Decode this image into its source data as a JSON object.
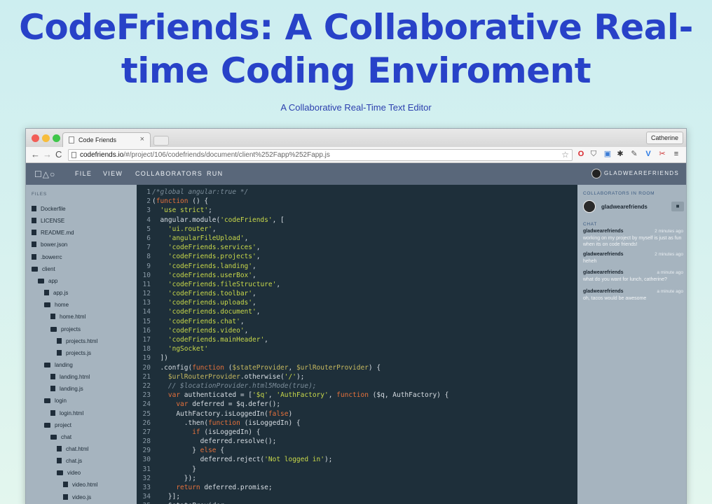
{
  "page": {
    "title_line1": "CodeFriends: A Collaborative Real-",
    "title_line2": "time Coding Enviroment",
    "subtitle": "A Collaborative Real-Time Text Editor"
  },
  "browser": {
    "tab_title": "Code Friends",
    "tab_close": "×",
    "profile_name": "Catherine",
    "url_host": "codefriends.io",
    "url_path": "/#/project/106/codefriends/document/client%252Fapp%252Fapp.js"
  },
  "app_nav": {
    "logo": "☐△○",
    "menu": [
      "FILE",
      "VIEW",
      "COLLABORATORS",
      "RUN"
    ],
    "username": "GLADWEAREFRIENDS"
  },
  "files": {
    "header": "FILES",
    "items": [
      {
        "name": "Dockerfile",
        "type": "file",
        "depth": 0
      },
      {
        "name": "LICENSE",
        "type": "file",
        "depth": 0
      },
      {
        "name": "README.md",
        "type": "file",
        "depth": 0
      },
      {
        "name": "bower.json",
        "type": "file",
        "depth": 0
      },
      {
        "name": ".bowerrc",
        "type": "file",
        "depth": 0
      },
      {
        "name": "client",
        "type": "folder",
        "depth": 0
      },
      {
        "name": "app",
        "type": "folder",
        "depth": 1
      },
      {
        "name": "app.js",
        "type": "file",
        "depth": 2
      },
      {
        "name": "home",
        "type": "folder",
        "depth": 2
      },
      {
        "name": "home.html",
        "type": "file",
        "depth": 3
      },
      {
        "name": "projects",
        "type": "folder",
        "depth": 3
      },
      {
        "name": "projects.html",
        "type": "file",
        "depth": 4
      },
      {
        "name": "projects.js",
        "type": "file",
        "depth": 4
      },
      {
        "name": "landing",
        "type": "folder",
        "depth": 2
      },
      {
        "name": "landing.html",
        "type": "file",
        "depth": 3
      },
      {
        "name": "landing.js",
        "type": "file",
        "depth": 3
      },
      {
        "name": "login",
        "type": "folder",
        "depth": 2
      },
      {
        "name": "login.html",
        "type": "file",
        "depth": 3
      },
      {
        "name": "project",
        "type": "folder",
        "depth": 2
      },
      {
        "name": "chat",
        "type": "folder",
        "depth": 3
      },
      {
        "name": "chat.html",
        "type": "file",
        "depth": 4
      },
      {
        "name": "chat.js",
        "type": "file",
        "depth": 4
      },
      {
        "name": "video",
        "type": "folder",
        "depth": 4
      },
      {
        "name": "video.html",
        "type": "file",
        "depth": 5
      },
      {
        "name": "video.js",
        "type": "file",
        "depth": 5
      }
    ]
  },
  "editor": {
    "lines": [
      [
        [
          "c-cm",
          "/*global angular:true */"
        ]
      ],
      [
        [
          "c-txt",
          "("
        ],
        [
          "c-kw",
          "function"
        ],
        [
          "c-txt",
          " () {"
        ]
      ],
      [
        [
          "c-txt",
          "  "
        ],
        [
          "c-str",
          "'use strict'"
        ],
        [
          "c-txt",
          ";"
        ]
      ],
      [
        [
          "c-txt",
          "  angular.module("
        ],
        [
          "c-str",
          "'codeFriends'"
        ],
        [
          "c-txt",
          ", ["
        ]
      ],
      [
        [
          "c-txt",
          "    "
        ],
        [
          "c-str",
          "'ui.router'"
        ],
        [
          "c-txt",
          ","
        ]
      ],
      [
        [
          "c-txt",
          "    "
        ],
        [
          "c-str",
          "'angularFileUpload'"
        ],
        [
          "c-txt",
          ","
        ]
      ],
      [
        [
          "c-txt",
          "    "
        ],
        [
          "c-str",
          "'codeFriends.services'"
        ],
        [
          "c-txt",
          ","
        ]
      ],
      [
        [
          "c-txt",
          "    "
        ],
        [
          "c-str",
          "'codeFriends.projects'"
        ],
        [
          "c-txt",
          ","
        ]
      ],
      [
        [
          "c-txt",
          "    "
        ],
        [
          "c-str",
          "'codeFriends.landing'"
        ],
        [
          "c-txt",
          ","
        ]
      ],
      [
        [
          "c-txt",
          "    "
        ],
        [
          "c-str",
          "'codeFriends.userBox'"
        ],
        [
          "c-txt",
          ","
        ]
      ],
      [
        [
          "c-txt",
          "    "
        ],
        [
          "c-str",
          "'codeFriends.fileStructure'"
        ],
        [
          "c-txt",
          ","
        ]
      ],
      [
        [
          "c-txt",
          "    "
        ],
        [
          "c-str",
          "'codeFriends.toolbar'"
        ],
        [
          "c-txt",
          ","
        ]
      ],
      [
        [
          "c-txt",
          "    "
        ],
        [
          "c-str",
          "'codeFriends.uploads'"
        ],
        [
          "c-txt",
          ","
        ]
      ],
      [
        [
          "c-txt",
          "    "
        ],
        [
          "c-str",
          "'codeFriends.document'"
        ],
        [
          "c-txt",
          ","
        ]
      ],
      [
        [
          "c-txt",
          "    "
        ],
        [
          "c-str",
          "'codeFriends.chat'"
        ],
        [
          "c-txt",
          ","
        ]
      ],
      [
        [
          "c-txt",
          "    "
        ],
        [
          "c-str",
          "'codeFriends.video'"
        ],
        [
          "c-txt",
          ","
        ]
      ],
      [
        [
          "c-txt",
          "    "
        ],
        [
          "c-str",
          "'codeFriends.mainHeader'"
        ],
        [
          "c-txt",
          ","
        ]
      ],
      [
        [
          "c-txt",
          "    "
        ],
        [
          "c-str",
          "'ngSocket'"
        ]
      ],
      [
        [
          "c-txt",
          "  ])"
        ]
      ],
      [
        [
          "c-txt",
          "  .config("
        ],
        [
          "c-kw",
          "function"
        ],
        [
          "c-txt",
          " ("
        ],
        [
          "c-var",
          "$stateProvider"
        ],
        [
          "c-txt",
          ", "
        ],
        [
          "c-var",
          "$urlRouterProvider"
        ],
        [
          "c-txt",
          ") {"
        ]
      ],
      [
        [
          "c-txt",
          "    "
        ],
        [
          "c-var",
          "$urlRouterProvider"
        ],
        [
          "c-txt",
          ".otherwise("
        ],
        [
          "c-str",
          "'/'"
        ],
        [
          "c-txt",
          ");"
        ]
      ],
      [
        [
          "c-txt",
          "    "
        ],
        [
          "c-cm",
          "// $locationProvider.html5Mode(true);"
        ]
      ],
      [
        [
          "c-txt",
          "    "
        ],
        [
          "c-kw",
          "var"
        ],
        [
          "c-txt",
          " authenticated = ["
        ],
        [
          "c-str",
          "'$q'"
        ],
        [
          "c-txt",
          ", "
        ],
        [
          "c-str",
          "'AuthFactory'"
        ],
        [
          "c-txt",
          ", "
        ],
        [
          "c-kw",
          "function"
        ],
        [
          "c-txt",
          " ($q, AuthFactory) {"
        ]
      ],
      [
        [
          "c-txt",
          "      "
        ],
        [
          "c-kw",
          "var"
        ],
        [
          "c-txt",
          " deferred = $q.defer();"
        ]
      ],
      [
        [
          "c-txt",
          "      AuthFactory.isLoggedIn("
        ],
        [
          "c-kw",
          "false"
        ],
        [
          "c-txt",
          ")"
        ]
      ],
      [
        [
          "c-txt",
          "        .then("
        ],
        [
          "c-kw",
          "function"
        ],
        [
          "c-txt",
          " (isLoggedIn) {"
        ]
      ],
      [
        [
          "c-txt",
          "          "
        ],
        [
          "c-kw",
          "if"
        ],
        [
          "c-txt",
          " (isLoggedIn) {"
        ]
      ],
      [
        [
          "c-txt",
          "            deferred.resolve();"
        ]
      ],
      [
        [
          "c-txt",
          "          } "
        ],
        [
          "c-kw",
          "else"
        ],
        [
          "c-txt",
          " {"
        ]
      ],
      [
        [
          "c-txt",
          "            deferred.reject("
        ],
        [
          "c-str",
          "'Not logged in'"
        ],
        [
          "c-txt",
          ");"
        ]
      ],
      [
        [
          "c-txt",
          "          }"
        ]
      ],
      [
        [
          "c-txt",
          "        });"
        ]
      ],
      [
        [
          "c-txt",
          "      "
        ],
        [
          "c-kw",
          "return"
        ],
        [
          "c-txt",
          " deferred.promise;"
        ]
      ],
      [
        [
          "c-txt",
          "    }];"
        ]
      ],
      [
        [
          "c-txt",
          "    $stateProvider"
        ]
      ]
    ]
  },
  "chat": {
    "collaborators_header": "COLLABORATORS IN ROOM",
    "collaborator_name": "gladwearefriends",
    "chat_header": "CHAT",
    "messages": [
      {
        "user": "gladwearefriends",
        "time": "2 minutes ago",
        "text": "working on my project by myself is just as fun when its on code friends!"
      },
      {
        "user": "gladwearefriends",
        "time": "2 minutes ago",
        "text": "heheh"
      },
      {
        "user": "gladwearefriends",
        "time": "a minute ago",
        "text": "what do you want for lunch, catherine?"
      },
      {
        "user": "gladwearefriends",
        "time": "a minute ago",
        "text": "oh, tacos would be awesome"
      }
    ]
  },
  "colors": {
    "title": "#2842c8",
    "app_nav_bg": "#59677a",
    "editor_bg": "#1e2f3a",
    "panel_bg": "#a6b4bf"
  }
}
